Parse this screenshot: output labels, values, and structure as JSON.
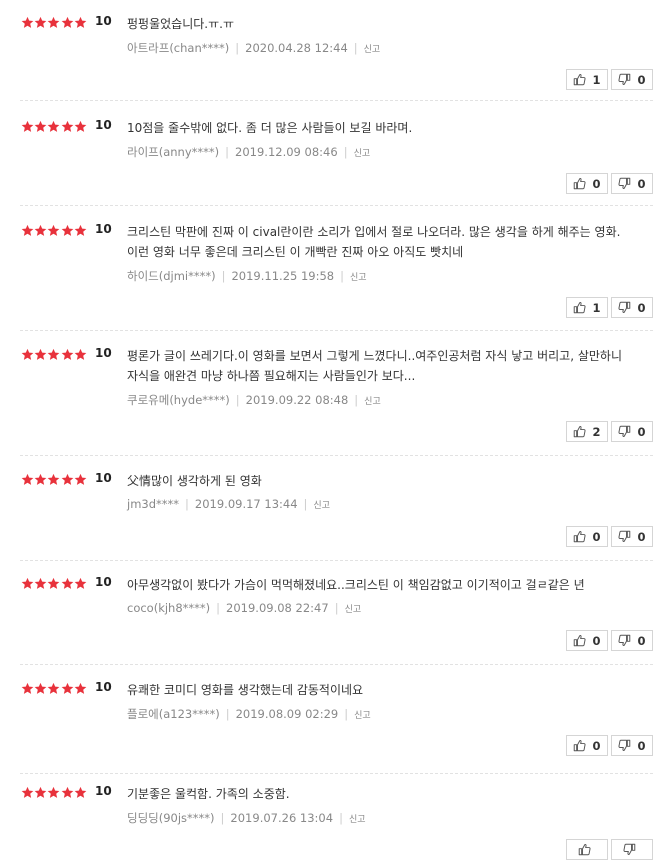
{
  "colors": {
    "star": "#e8323c",
    "meta": "#888888",
    "text": "#333333"
  },
  "icons": {
    "like": "thumbs-up-icon",
    "dislike": "thumbs-down-icon",
    "star": "star-icon"
  },
  "reviews": [
    {
      "rating": 5,
      "score": "10",
      "text": "펑펑울었습니다.ㅠ.ㅠ",
      "author": "아트라프(chan****)",
      "date": "2020.04.28 12:44",
      "report": "신고",
      "likes": "1",
      "dislikes": "0"
    },
    {
      "rating": 5,
      "score": "10",
      "text": "10점을 줄수밖에 없다. 좀 더 많은 사람들이 보길 바라며.",
      "author": "라이프(anny****)",
      "date": "2019.12.09 08:46",
      "report": "신고",
      "likes": "0",
      "dislikes": "0"
    },
    {
      "rating": 5,
      "score": "10",
      "text": "크리스틴 막판에 진짜 이 cival란이란 소리가 입에서 절로 나오더라. 많은 생각을 하게 해주는 영화. 이런 영화 너무 좋은데 크리스틴 이 개빡란 진짜 아오 아직도 빳치네",
      "author": "하이드(djmi****)",
      "date": "2019.11.25 19:58",
      "report": "신고",
      "likes": "1",
      "dislikes": "0"
    },
    {
      "rating": 5,
      "score": "10",
      "text": "평론가 글이 쓰레기다.이 영화를 보면서 그렇게 느꼈다니..여주인공처럼 자식 낳고 버리고, 살만하니 자식을 애완견 마냥 하나쯤 필요해지는 사람들인가 보다...",
      "author": "쿠로유메(hyde****)",
      "date": "2019.09.22 08:48",
      "report": "신고",
      "likes": "2",
      "dislikes": "0"
    },
    {
      "rating": 5,
      "score": "10",
      "text": "父情많이 생각하게 된 영화",
      "author": "jm3d****",
      "date": "2019.09.17 13:44",
      "report": "신고",
      "likes": "0",
      "dislikes": "0"
    },
    {
      "rating": 5,
      "score": "10",
      "text": "아무생각없이 봤다가 가슴이 먹먹해졌네요..크리스틴 이 책임감없고 이기적이고 걸ㄹ같은 년",
      "author": "coco(kjh8****)",
      "date": "2019.09.08 22:47",
      "report": "신고",
      "likes": "0",
      "dislikes": "0"
    },
    {
      "rating": 5,
      "score": "10",
      "text": "유쾌한 코미디 영화를 생각했는데 감동적이네요",
      "author": "플로에(a123****)",
      "date": "2019.08.09 02:29",
      "report": "신고",
      "likes": "0",
      "dislikes": "0"
    },
    {
      "rating": 5,
      "score": "10",
      "text": "기분좋은 울컥함. 가족의 소중함.",
      "author": "딩딩딩(90js****)",
      "date": "2019.07.26 13:04",
      "report": "신고",
      "likes": "",
      "dislikes": ""
    }
  ]
}
